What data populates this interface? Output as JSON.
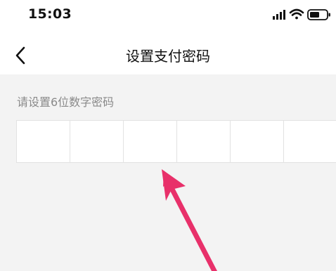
{
  "status_bar": {
    "time": "15:03",
    "icons": [
      "signal-icon",
      "wifi-icon",
      "battery-icon"
    ]
  },
  "nav": {
    "back_icon": "chevron-left-icon",
    "title": "设置支付密码"
  },
  "form": {
    "hint": "请设置6位数字密码",
    "digit_count": 6,
    "digits": [
      "",
      "",
      "",
      "",
      "",
      ""
    ]
  },
  "annotation": {
    "icon": "arrow-annotation",
    "color": "#e8306a"
  }
}
